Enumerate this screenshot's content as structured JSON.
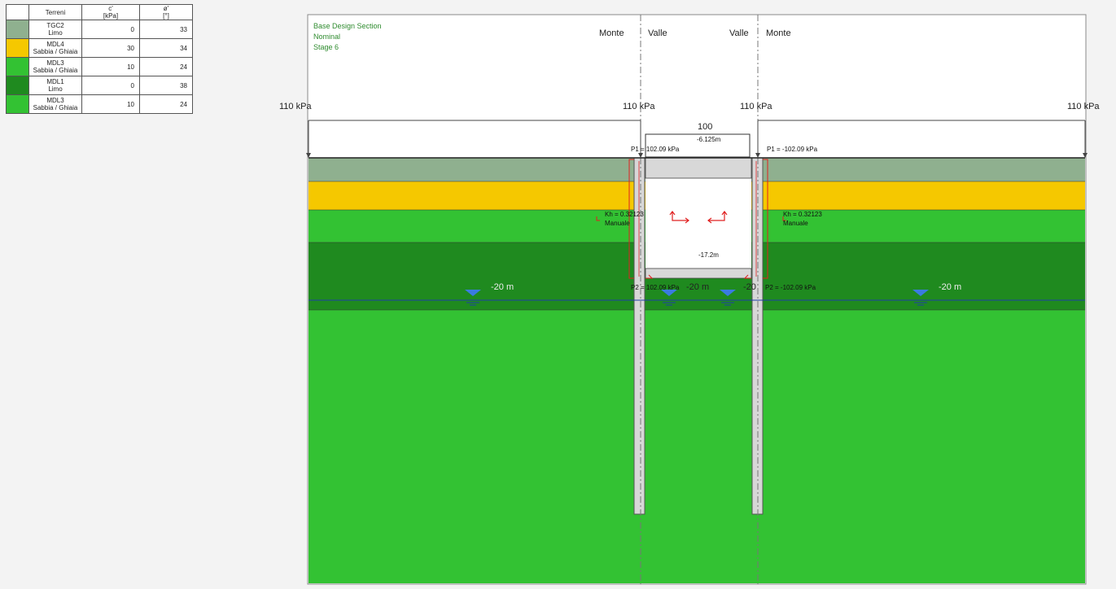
{
  "legend": {
    "headers": {
      "name": "Terreni",
      "c": "c'",
      "c_unit": "[kPa]",
      "phi": "ø'",
      "phi_unit": "[°]"
    },
    "rows": [
      {
        "name1": "TGC2",
        "name2": "Limo",
        "c": "0",
        "phi": "33",
        "color": "#8fb08f"
      },
      {
        "name1": "MDL4",
        "name2": "Sabbia / Ghiaia",
        "c": "30",
        "phi": "34",
        "color": "#f5c800"
      },
      {
        "name1": "MDL3",
        "name2": "Sabbia / Ghiaia",
        "c": "10",
        "phi": "24",
        "color": "#33c233"
      },
      {
        "name1": "MDL1",
        "name2": "Limo",
        "c": "0",
        "phi": "38",
        "color": "#1f8a1f"
      },
      {
        "name1": "MDL3",
        "name2": "Sabbia / Ghiaia",
        "c": "10",
        "phi": "24",
        "color": "#33c233"
      }
    ]
  },
  "section": {
    "title": "Base Design Section",
    "subtitle": "Nominal",
    "stage": "Stage 6",
    "monte_left": "Monte",
    "valle_left": "Valle",
    "valle_right": "Valle",
    "monte_right": "Monte"
  },
  "loads": {
    "q1": "110 kPa",
    "q2": "110 kPa",
    "q3": "110 kPa",
    "q4": "110 kPa",
    "strut_value": "100",
    "strut_level": "-6.125m",
    "p1_left": "P1 = 102.09 kPa",
    "p1_right": "P1 = -102.09 kPa",
    "p2_left": "P2 = 102.09 kPa",
    "p2_right": "P2 = -102.09 kPa",
    "kh_left": "Kh = 0.32123",
    "kh_right": "Kh = 0.32123",
    "manuale_left": "Manuale",
    "manuale_right": "Manuale",
    "excavation_level": "-17.2m"
  },
  "water": {
    "w1": "-20 m",
    "w2": "-20 m",
    "w3": "-20",
    "w4": "-20 m"
  },
  "colors": {
    "tgc2": "#8fb08f",
    "mdl4": "#f5c800",
    "mdl3": "#33c233",
    "mdl1": "#1f8a1f",
    "wall": "#d7d7d7",
    "water_line": "#1f3fa8",
    "load_red": "#e02020"
  }
}
